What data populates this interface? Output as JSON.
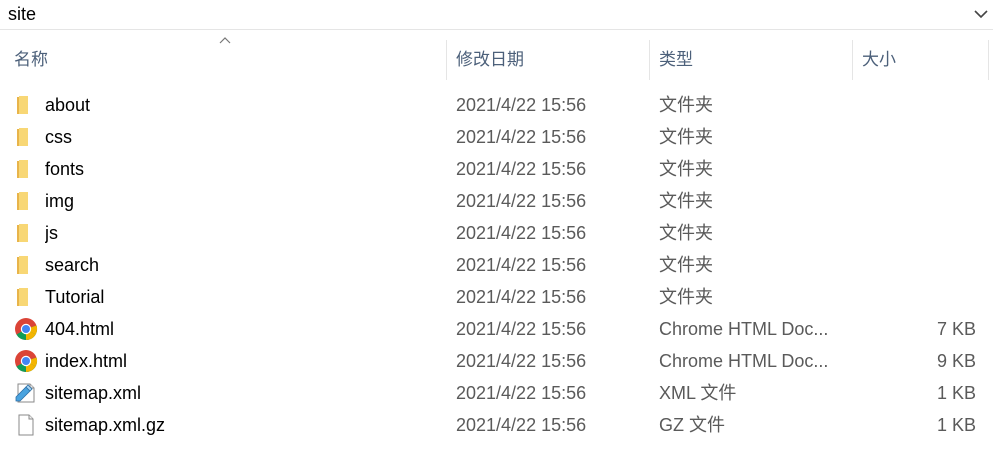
{
  "path": {
    "current": "site"
  },
  "columns": {
    "name": "名称",
    "date": "修改日期",
    "type": "类型",
    "size": "大小"
  },
  "files": [
    {
      "name": "about",
      "date": "2021/4/22 15:56",
      "type": "文件夹",
      "size": "",
      "icon": "folder-icon"
    },
    {
      "name": "css",
      "date": "2021/4/22 15:56",
      "type": "文件夹",
      "size": "",
      "icon": "folder-icon"
    },
    {
      "name": "fonts",
      "date": "2021/4/22 15:56",
      "type": "文件夹",
      "size": "",
      "icon": "folder-icon"
    },
    {
      "name": "img",
      "date": "2021/4/22 15:56",
      "type": "文件夹",
      "size": "",
      "icon": "folder-icon"
    },
    {
      "name": "js",
      "date": "2021/4/22 15:56",
      "type": "文件夹",
      "size": "",
      "icon": "folder-icon"
    },
    {
      "name": "search",
      "date": "2021/4/22 15:56",
      "type": "文件夹",
      "size": "",
      "icon": "folder-icon"
    },
    {
      "name": "Tutorial",
      "date": "2021/4/22 15:56",
      "type": "文件夹",
      "size": "",
      "icon": "folder-icon"
    },
    {
      "name": "404.html",
      "date": "2021/4/22 15:56",
      "type": "Chrome HTML Doc...",
      "size": "7 KB",
      "icon": "chrome-icon"
    },
    {
      "name": "index.html",
      "date": "2021/4/22 15:56",
      "type": "Chrome HTML Doc...",
      "size": "9 KB",
      "icon": "chrome-icon"
    },
    {
      "name": "sitemap.xml",
      "date": "2021/4/22 15:56",
      "type": "XML 文件",
      "size": "1 KB",
      "icon": "xml-file-icon"
    },
    {
      "name": "sitemap.xml.gz",
      "date": "2021/4/22 15:56",
      "type": "GZ 文件",
      "size": "1 KB",
      "icon": "blank-file-icon"
    }
  ],
  "colors": {
    "folder": "#f8d775",
    "folder_dark": "#e8b44a",
    "header_text": "#4c607a",
    "chrome_red": "#db4437",
    "chrome_green": "#0f9d58",
    "chrome_yellow": "#f4b400",
    "chrome_blue": "#4285f4"
  }
}
